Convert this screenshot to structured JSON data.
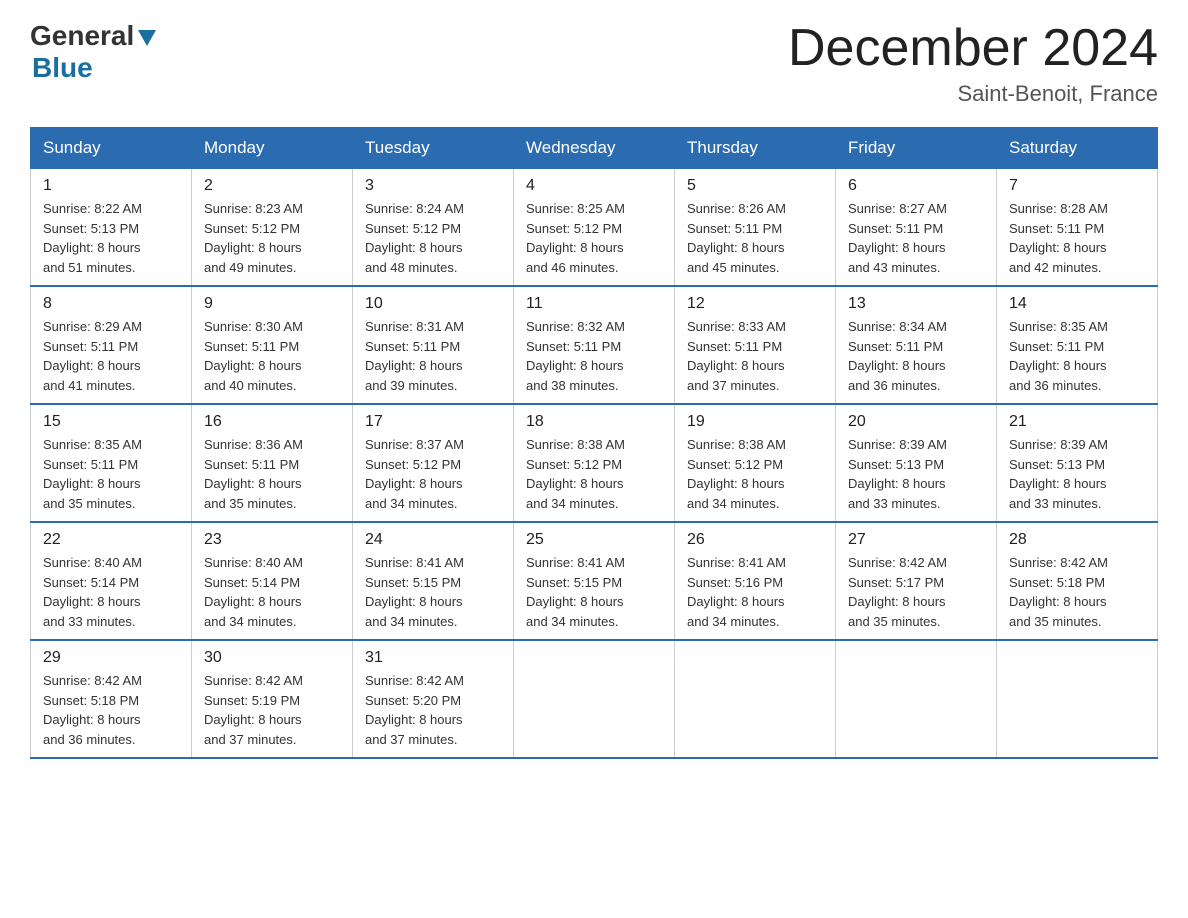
{
  "logo": {
    "general": "General",
    "arrow": "▶",
    "blue": "Blue"
  },
  "title": "December 2024",
  "subtitle": "Saint-Benoit, France",
  "headers": [
    "Sunday",
    "Monday",
    "Tuesday",
    "Wednesday",
    "Thursday",
    "Friday",
    "Saturday"
  ],
  "weeks": [
    [
      {
        "day": "1",
        "sunrise": "8:22 AM",
        "sunset": "5:13 PM",
        "daylight": "8 hours and 51 minutes."
      },
      {
        "day": "2",
        "sunrise": "8:23 AM",
        "sunset": "5:12 PM",
        "daylight": "8 hours and 49 minutes."
      },
      {
        "day": "3",
        "sunrise": "8:24 AM",
        "sunset": "5:12 PM",
        "daylight": "8 hours and 48 minutes."
      },
      {
        "day": "4",
        "sunrise": "8:25 AM",
        "sunset": "5:12 PM",
        "daylight": "8 hours and 46 minutes."
      },
      {
        "day": "5",
        "sunrise": "8:26 AM",
        "sunset": "5:11 PM",
        "daylight": "8 hours and 45 minutes."
      },
      {
        "day": "6",
        "sunrise": "8:27 AM",
        "sunset": "5:11 PM",
        "daylight": "8 hours and 43 minutes."
      },
      {
        "day": "7",
        "sunrise": "8:28 AM",
        "sunset": "5:11 PM",
        "daylight": "8 hours and 42 minutes."
      }
    ],
    [
      {
        "day": "8",
        "sunrise": "8:29 AM",
        "sunset": "5:11 PM",
        "daylight": "8 hours and 41 minutes."
      },
      {
        "day": "9",
        "sunrise": "8:30 AM",
        "sunset": "5:11 PM",
        "daylight": "8 hours and 40 minutes."
      },
      {
        "day": "10",
        "sunrise": "8:31 AM",
        "sunset": "5:11 PM",
        "daylight": "8 hours and 39 minutes."
      },
      {
        "day": "11",
        "sunrise": "8:32 AM",
        "sunset": "5:11 PM",
        "daylight": "8 hours and 38 minutes."
      },
      {
        "day": "12",
        "sunrise": "8:33 AM",
        "sunset": "5:11 PM",
        "daylight": "8 hours and 37 minutes."
      },
      {
        "day": "13",
        "sunrise": "8:34 AM",
        "sunset": "5:11 PM",
        "daylight": "8 hours and 36 minutes."
      },
      {
        "day": "14",
        "sunrise": "8:35 AM",
        "sunset": "5:11 PM",
        "daylight": "8 hours and 36 minutes."
      }
    ],
    [
      {
        "day": "15",
        "sunrise": "8:35 AM",
        "sunset": "5:11 PM",
        "daylight": "8 hours and 35 minutes."
      },
      {
        "day": "16",
        "sunrise": "8:36 AM",
        "sunset": "5:11 PM",
        "daylight": "8 hours and 35 minutes."
      },
      {
        "day": "17",
        "sunrise": "8:37 AM",
        "sunset": "5:12 PM",
        "daylight": "8 hours and 34 minutes."
      },
      {
        "day": "18",
        "sunrise": "8:38 AM",
        "sunset": "5:12 PM",
        "daylight": "8 hours and 34 minutes."
      },
      {
        "day": "19",
        "sunrise": "8:38 AM",
        "sunset": "5:12 PM",
        "daylight": "8 hours and 34 minutes."
      },
      {
        "day": "20",
        "sunrise": "8:39 AM",
        "sunset": "5:13 PM",
        "daylight": "8 hours and 33 minutes."
      },
      {
        "day": "21",
        "sunrise": "8:39 AM",
        "sunset": "5:13 PM",
        "daylight": "8 hours and 33 minutes."
      }
    ],
    [
      {
        "day": "22",
        "sunrise": "8:40 AM",
        "sunset": "5:14 PM",
        "daylight": "8 hours and 33 minutes."
      },
      {
        "day": "23",
        "sunrise": "8:40 AM",
        "sunset": "5:14 PM",
        "daylight": "8 hours and 34 minutes."
      },
      {
        "day": "24",
        "sunrise": "8:41 AM",
        "sunset": "5:15 PM",
        "daylight": "8 hours and 34 minutes."
      },
      {
        "day": "25",
        "sunrise": "8:41 AM",
        "sunset": "5:15 PM",
        "daylight": "8 hours and 34 minutes."
      },
      {
        "day": "26",
        "sunrise": "8:41 AM",
        "sunset": "5:16 PM",
        "daylight": "8 hours and 34 minutes."
      },
      {
        "day": "27",
        "sunrise": "8:42 AM",
        "sunset": "5:17 PM",
        "daylight": "8 hours and 35 minutes."
      },
      {
        "day": "28",
        "sunrise": "8:42 AM",
        "sunset": "5:18 PM",
        "daylight": "8 hours and 35 minutes."
      }
    ],
    [
      {
        "day": "29",
        "sunrise": "8:42 AM",
        "sunset": "5:18 PM",
        "daylight": "8 hours and 36 minutes."
      },
      {
        "day": "30",
        "sunrise": "8:42 AM",
        "sunset": "5:19 PM",
        "daylight": "8 hours and 37 minutes."
      },
      {
        "day": "31",
        "sunrise": "8:42 AM",
        "sunset": "5:20 PM",
        "daylight": "8 hours and 37 minutes."
      },
      null,
      null,
      null,
      null
    ]
  ],
  "labels": {
    "sunrise": "Sunrise:",
    "sunset": "Sunset:",
    "daylight": "Daylight:"
  }
}
